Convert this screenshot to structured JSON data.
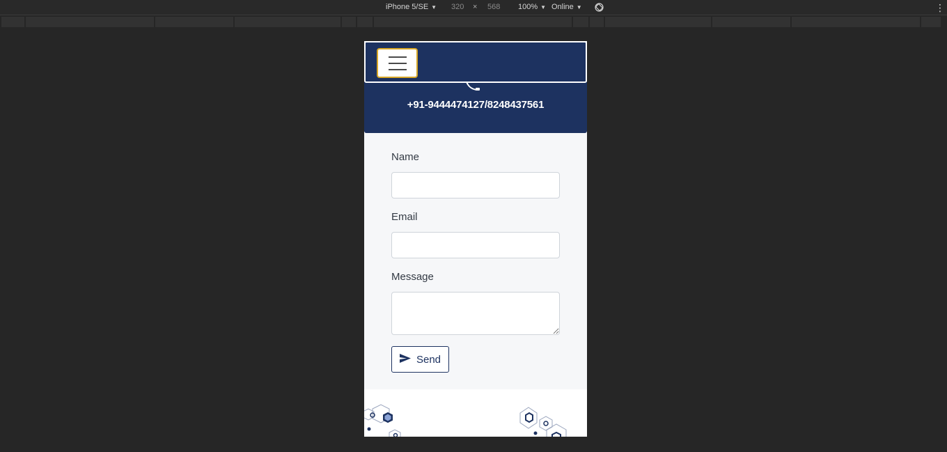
{
  "devtools": {
    "device": "iPhone 5/SE",
    "width": "320",
    "times": "×",
    "height": "568",
    "zoom": "100%",
    "network": "Online",
    "caret": "▼",
    "more_icon": "kebab-icon",
    "rotate_icon": "rotate-icon"
  },
  "navbar": {
    "background": "#1d3260",
    "toggle_border": "#d8a726",
    "toggle_icon": "hamburger-icon"
  },
  "contact": {
    "phone_icon": "phone-icon",
    "phone": "+91-9444474127/8248437561"
  },
  "form": {
    "name_label": "Name",
    "name_value": "",
    "email_label": "Email",
    "email_value": "",
    "message_label": "Message",
    "message_value": "",
    "send_label": "Send",
    "send_icon": "paper-plane-icon"
  },
  "colors": {
    "accent": "#1d3260",
    "form_bg": "#f6f7f9",
    "page_bg": "#262626"
  }
}
